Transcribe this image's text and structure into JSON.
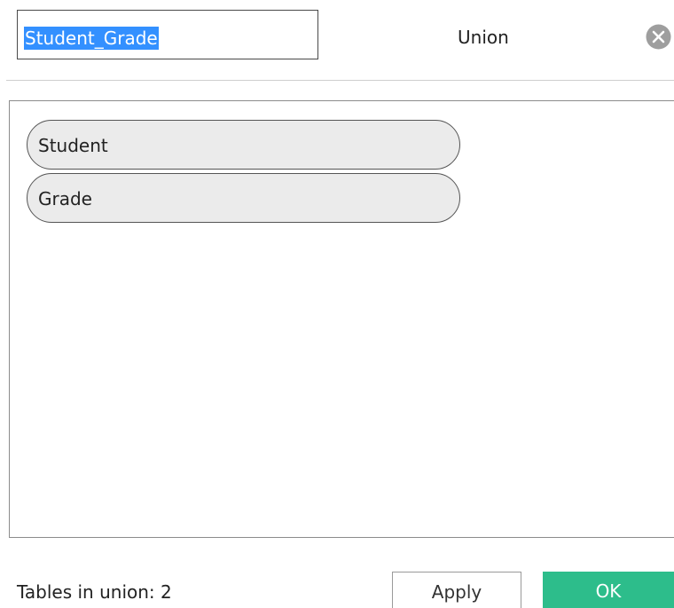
{
  "dialog": {
    "title": "Union",
    "name_value": "Student_Grade",
    "close_icon": "close-circle-icon"
  },
  "tables": [
    {
      "label": "Student"
    },
    {
      "label": "Grade"
    }
  ],
  "footer": {
    "count_label": "Tables in union: 2",
    "apply_label": "Apply",
    "ok_label": "OK"
  },
  "colors": {
    "selection": "#3390ff",
    "pill_fill": "#ebebeb",
    "ok_button": "#2dbd8b",
    "close_icon": "#9e9e9e"
  }
}
